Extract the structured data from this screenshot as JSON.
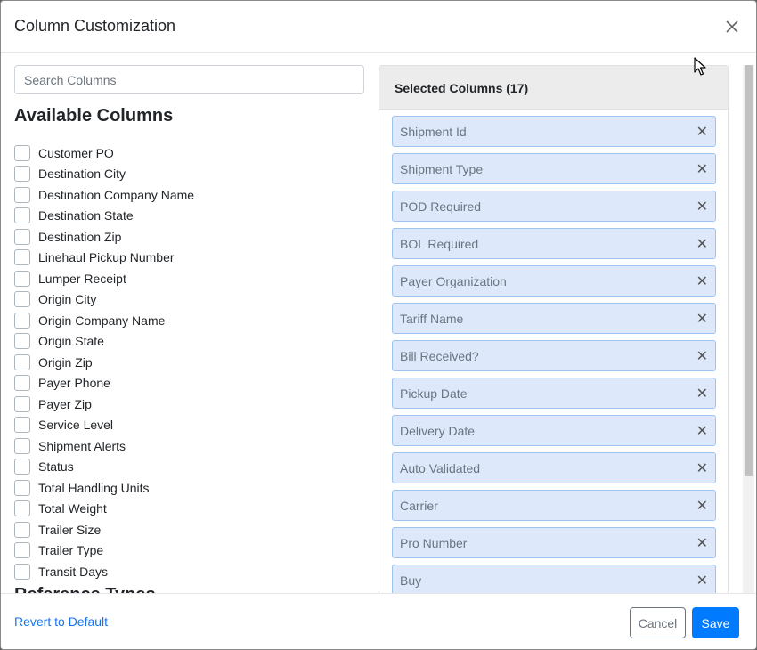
{
  "modal": {
    "title": "Column Customization"
  },
  "search": {
    "placeholder": "Search Columns",
    "value": ""
  },
  "available": {
    "title": "Available Columns",
    "items": [
      "Customer PO",
      "Destination City",
      "Destination Company Name",
      "Destination State",
      "Destination Zip",
      "Linehaul Pickup Number",
      "Lumper Receipt",
      "Origin City",
      "Origin Company Name",
      "Origin State",
      "Origin Zip",
      "Payer Phone",
      "Payer Zip",
      "Service Level",
      "Shipment Alerts",
      "Status",
      "Total Handling Units",
      "Total Weight",
      "Trailer Size",
      "Trailer Type",
      "Transit Days"
    ],
    "next_heading": "Reference Types"
  },
  "selected": {
    "header": "Selected Columns (17)",
    "items": [
      "Shipment Id",
      "Shipment Type",
      "POD Required",
      "BOL Required",
      "Payer Organization",
      "Tariff Name",
      "Bill Received?",
      "Pickup Date",
      "Delivery Date",
      "Auto Validated",
      "Carrier",
      "Pro Number",
      "Buy"
    ],
    "remove_glyph": "✕"
  },
  "footer": {
    "revert_label": "Revert to Default",
    "cancel_label": "Cancel",
    "save_label": "Save"
  },
  "icons": {
    "close": "close-icon",
    "remove": "remove-icon",
    "cursor": "mouse-pointer-icon"
  },
  "colors": {
    "accent": "#007bff",
    "chip_bg": "#dde9fb",
    "chip_border": "#9fc3f0",
    "link": "#1a73e8"
  }
}
